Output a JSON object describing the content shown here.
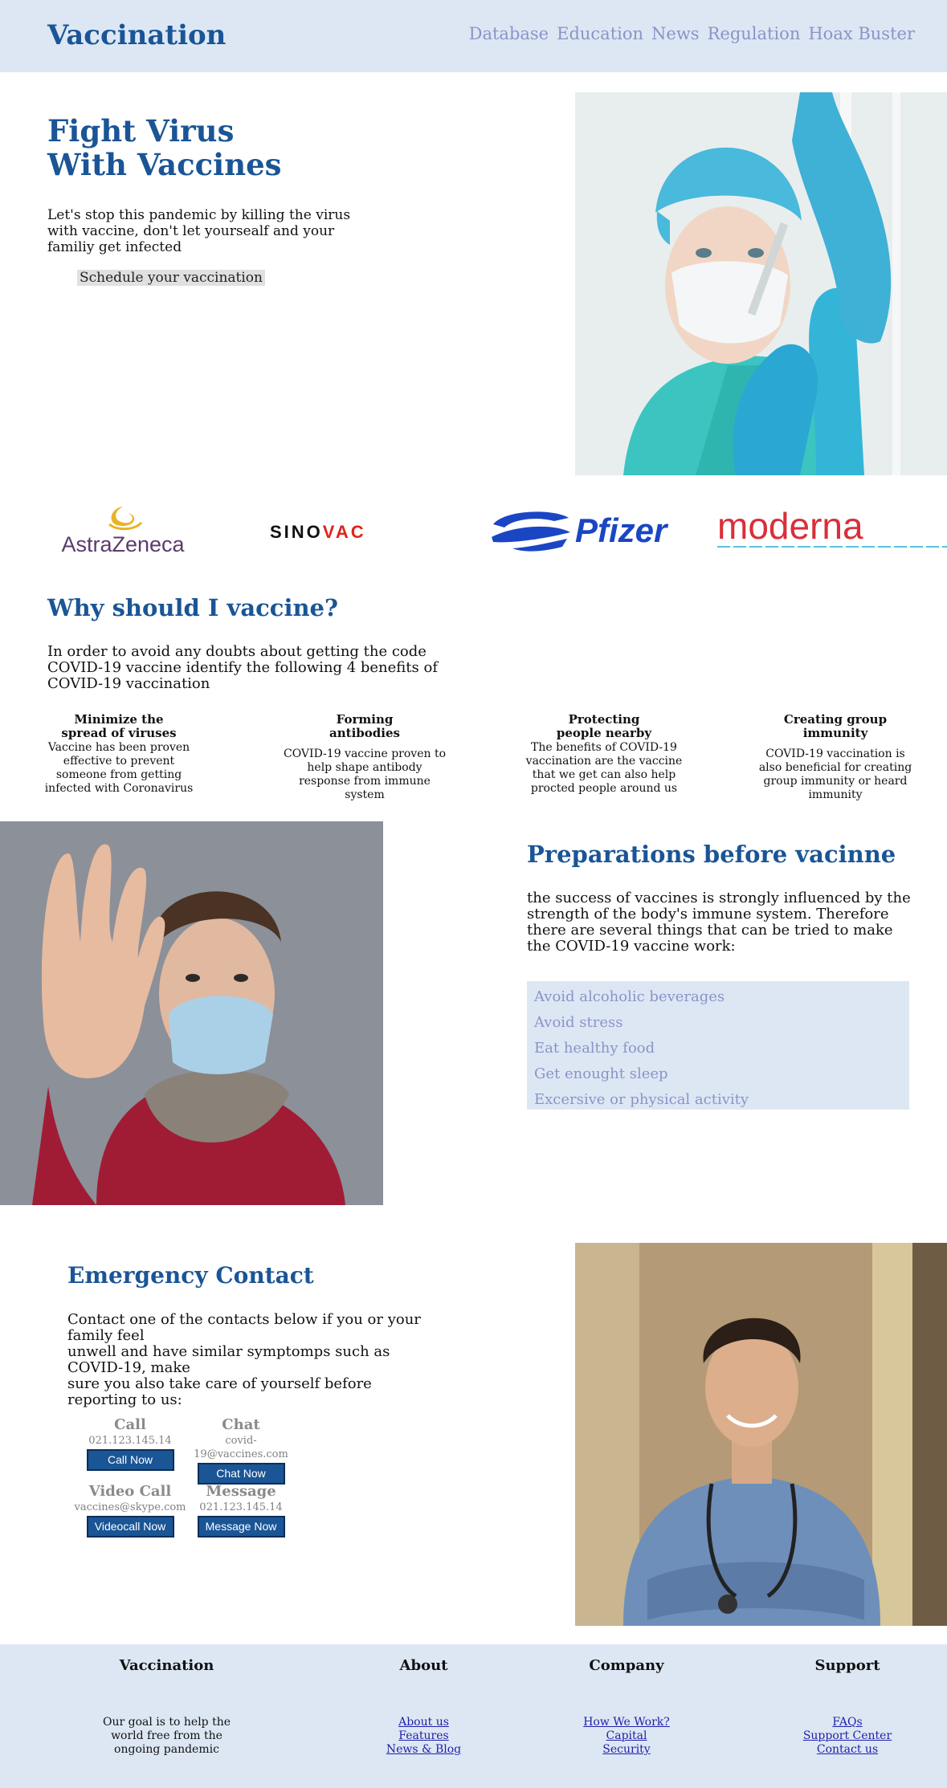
{
  "header": {
    "brand": "Vaccination",
    "nav": [
      "Database",
      "Education",
      "News",
      "Regulation",
      "Hoax Buster"
    ]
  },
  "hero": {
    "title_line1": "Fight Virus",
    "title_line2": "With Vaccines",
    "text": "Let's stop this pandemic by killing the virus with vaccine, don't let yoursealf and your familiy get infected",
    "button": "Schedule your vaccination"
  },
  "logos": {
    "astrazeneca": "AstraZeneca",
    "sinovac_a": "SINO",
    "sinovac_b": "VAC",
    "pfizer": "Pfizer",
    "moderna": "moderna"
  },
  "why": {
    "title": "Why should I vaccine?",
    "text": "In order to avoid any doubts about getting the code COVID-19 vaccine identify the following 4 benefits of COVID-19 vaccination",
    "benefits": [
      {
        "title_line1": "Minimize the",
        "title_line2": "spread of viruses",
        "text": "Vaccine has been proven effective to prevent someone from getting infected with Coronavirus"
      },
      {
        "title_line1": "Forming",
        "title_line2": "antibodies",
        "text": "COVID-19 vaccine proven to help shape antibody response from immune system"
      },
      {
        "title_line1": "Protecting",
        "title_line2": "people nearby",
        "text": "The benefits of COVID-19 vaccination are the vaccine that we get can also help procted people around us"
      },
      {
        "title_line1": "Creating group",
        "title_line2": "immunity",
        "text": "COVID-19 vaccination is also beneficial for creating group immunity or heard immunity"
      }
    ]
  },
  "preparations": {
    "title": "Preparations before vacinne",
    "text": "the success of vaccines is strongly influenced by the strength of the body's immune system. Therefore there are several things that can be tried to make the COVID-19 vaccine work:",
    "items": [
      "Avoid alcoholic beverages",
      "Avoid stress",
      "Eat healthy food",
      "Get enought sleep",
      "Excersive or physical activity"
    ]
  },
  "emergency": {
    "title": "Emergency Contact",
    "line1": "Contact one of the contacts below if you or your family feel",
    "line2": "unwell and have similar symptomps such as COVID-19, make",
    "line3": "sure you also take care of yourself before reporting to us:",
    "contacts": [
      {
        "heading": "Call",
        "value": "021.123.145.14",
        "button": "Call Now"
      },
      {
        "heading": "Chat",
        "value": "covid-19@vaccines.com",
        "button": "Chat Now"
      },
      {
        "heading": "Video Call",
        "value": "vaccines@skype.com",
        "button": "Videocall Now"
      },
      {
        "heading": "Message",
        "value": "021.123.145.14",
        "button": "Message Now"
      }
    ]
  },
  "footer": {
    "cols": [
      {
        "heading": "Vaccination",
        "text_line1": "Our goal is to help the",
        "text_line2": "world free from the",
        "text_line3": "ongoing pandemic"
      },
      {
        "heading": "About",
        "links": [
          "About us",
          "Features",
          "News & Blog"
        ]
      },
      {
        "heading": "Company",
        "links": [
          "How We Work?",
          "Capital",
          "Security"
        ]
      },
      {
        "heading": "Support",
        "links": [
          "FAQs",
          "Support Center",
          "Contact us"
        ]
      }
    ]
  },
  "colors": {
    "brand_blue": "#1a5596",
    "nav_lavender": "#8c93c7",
    "panel_bg": "#dde7f4"
  }
}
